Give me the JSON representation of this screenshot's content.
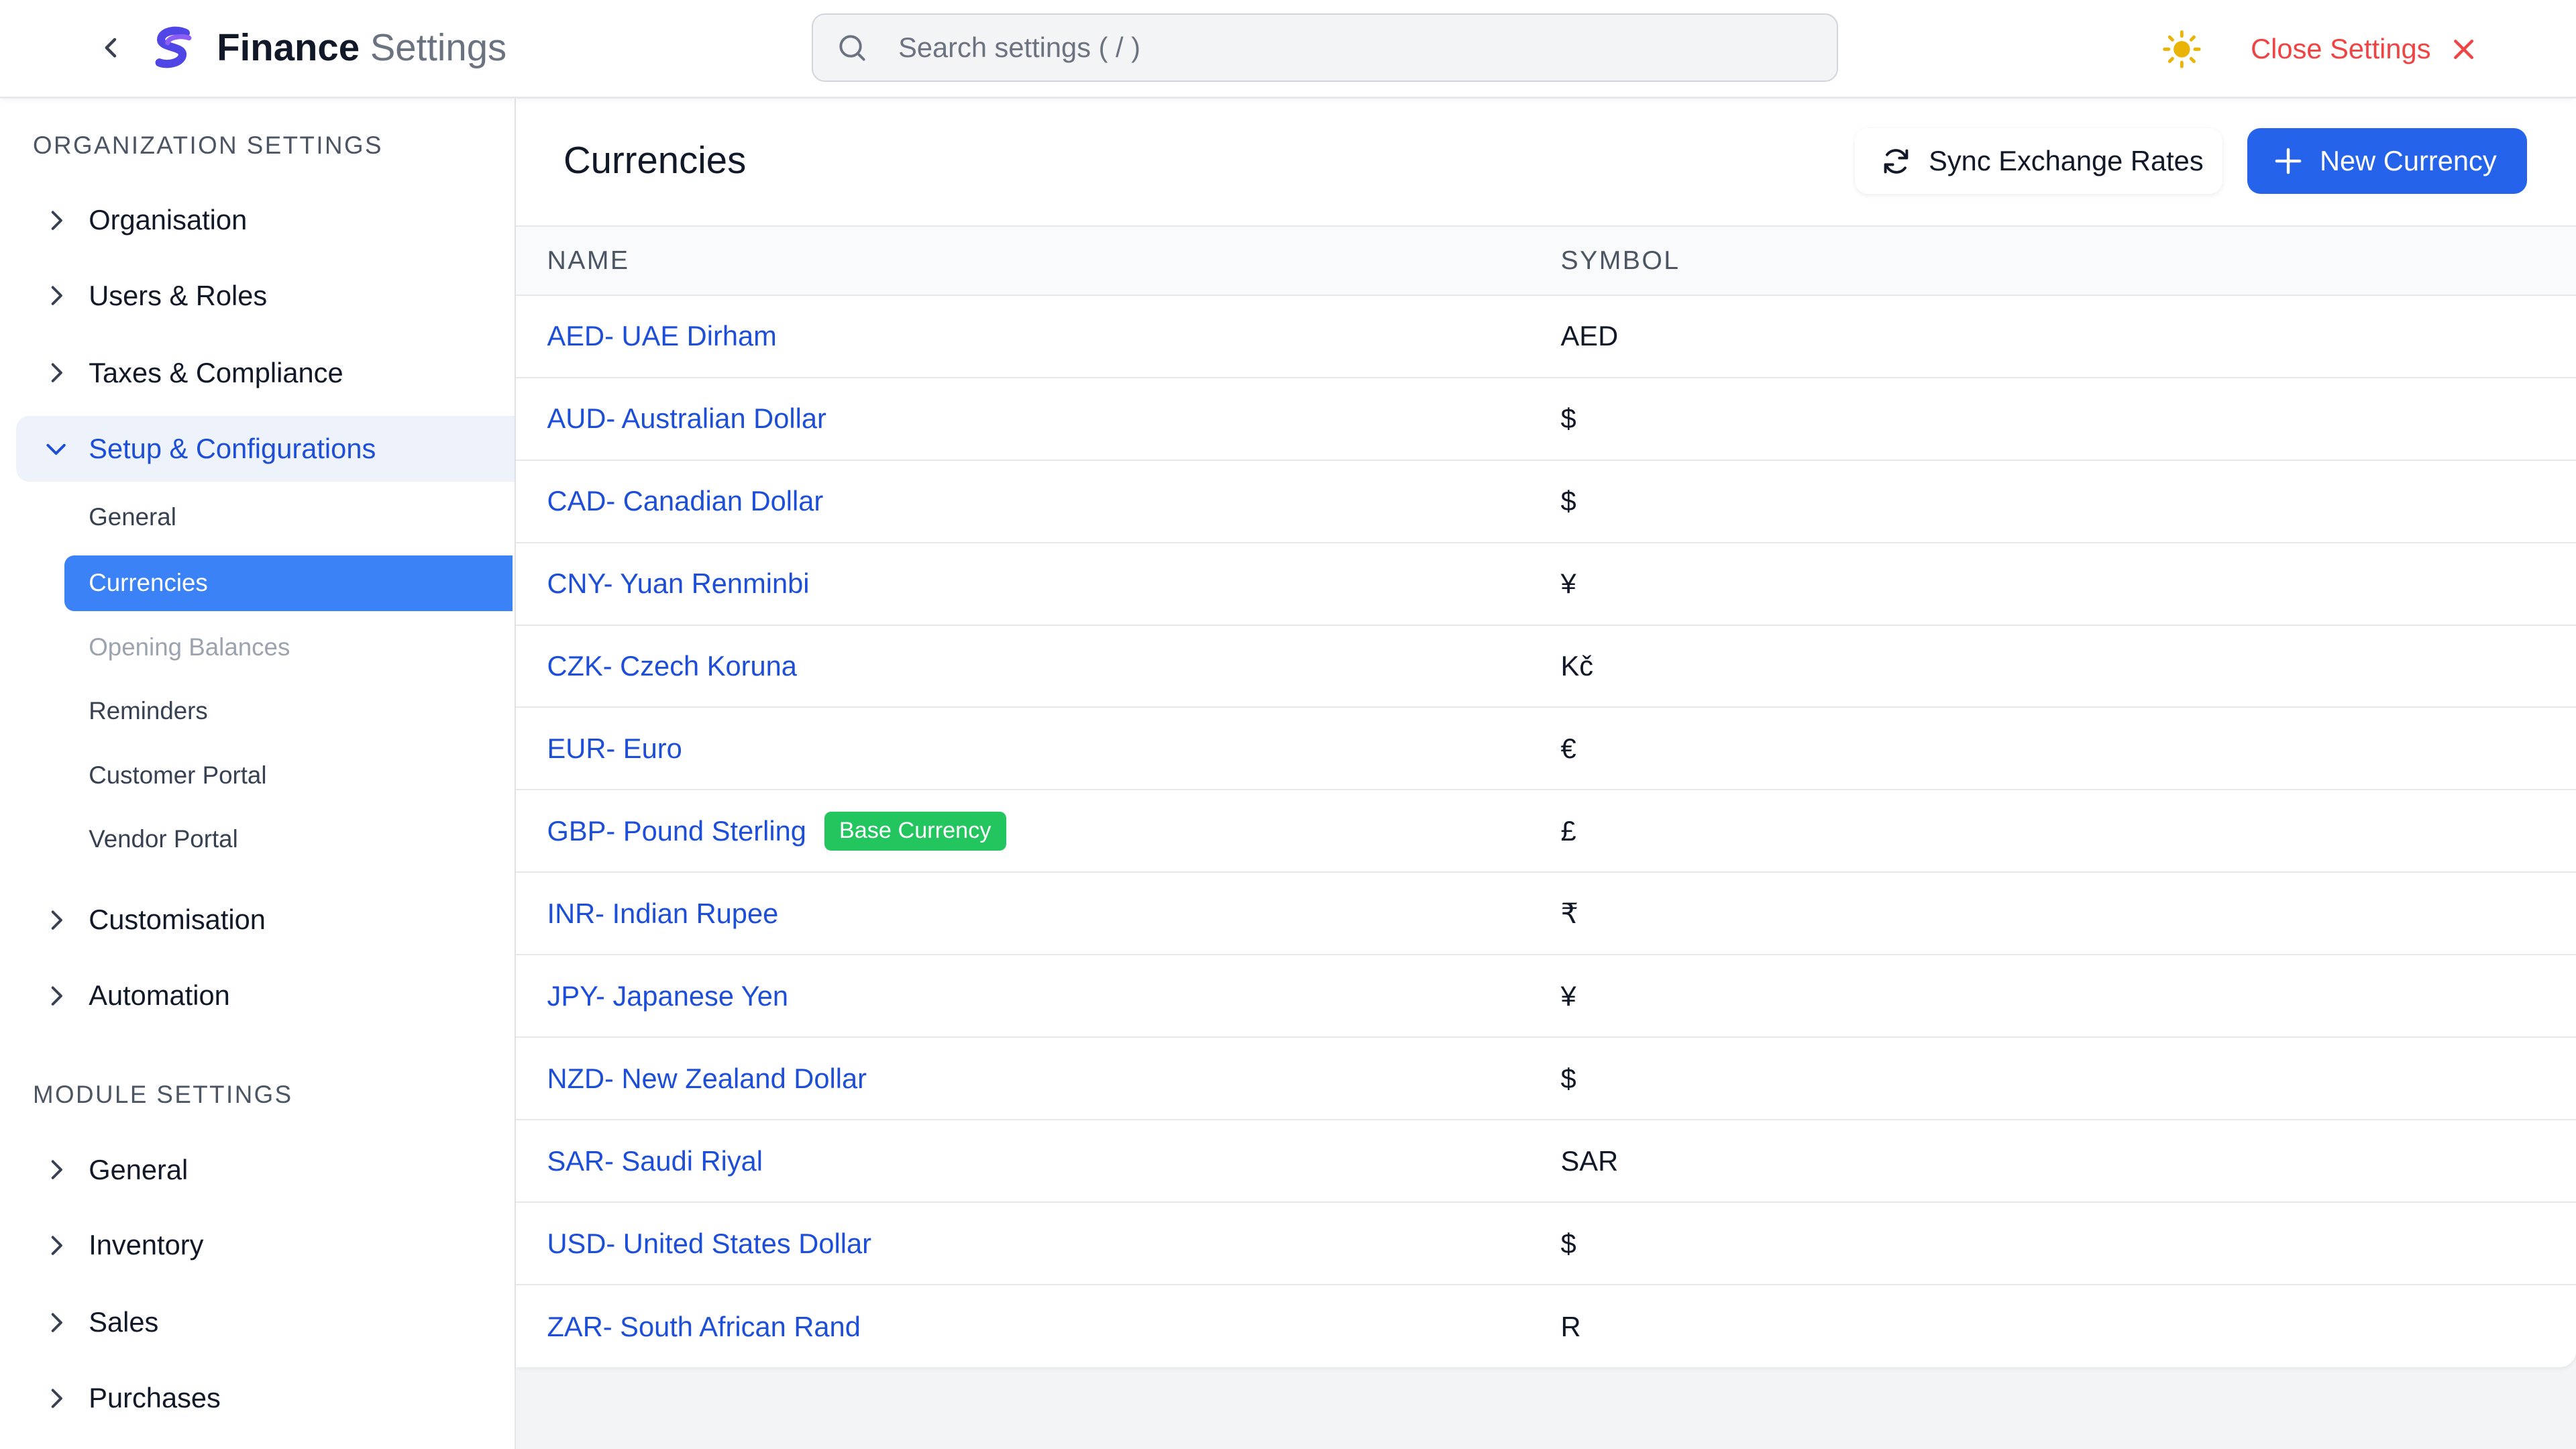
{
  "header": {
    "title_strong": "Finance",
    "title_light": "Settings",
    "search_placeholder": "Search settings ( / )",
    "close_label": "Close Settings"
  },
  "colors": {
    "accent": "#2563eb",
    "danger": "#ef4444",
    "badge": "#22c55e",
    "sun": "#eab308"
  },
  "sidebar": {
    "org_section": "ORGANIZATION SETTINGS",
    "org_items": [
      {
        "label": "Organisation"
      },
      {
        "label": "Users & Roles"
      },
      {
        "label": "Taxes & Compliance"
      },
      {
        "label": "Setup & Configurations"
      }
    ],
    "setup_subitems": [
      {
        "label": "General"
      },
      {
        "label": "Currencies"
      },
      {
        "label": "Opening Balances"
      },
      {
        "label": "Reminders"
      },
      {
        "label": "Customer Portal"
      },
      {
        "label": "Vendor Portal"
      }
    ],
    "org_items_after": [
      {
        "label": "Customisation"
      },
      {
        "label": "Automation"
      }
    ],
    "module_section": "MODULE SETTINGS",
    "module_items": [
      {
        "label": "General"
      },
      {
        "label": "Inventory"
      },
      {
        "label": "Sales"
      },
      {
        "label": "Purchases"
      }
    ]
  },
  "main": {
    "title": "Currencies",
    "sync_label": "Sync Exchange Rates",
    "new_label": "New Currency",
    "columns": {
      "name": "NAME",
      "symbol": "SYMBOL"
    },
    "base_badge": "Base Currency",
    "rows": [
      {
        "name": "AED- UAE Dirham",
        "symbol": "AED"
      },
      {
        "name": "AUD- Australian Dollar",
        "symbol": "$"
      },
      {
        "name": "CAD- Canadian Dollar",
        "symbol": "$"
      },
      {
        "name": "CNY- Yuan Renminbi",
        "symbol": "¥"
      },
      {
        "name": "CZK- Czech Koruna",
        "symbol": "Kč"
      },
      {
        "name": "EUR- Euro",
        "symbol": "€"
      },
      {
        "name": "GBP- Pound Sterling",
        "symbol": "£"
      },
      {
        "name": "INR- Indian Rupee",
        "symbol": "₹"
      },
      {
        "name": "JPY- Japanese Yen",
        "symbol": "¥"
      },
      {
        "name": "NZD- New Zealand Dollar",
        "symbol": "$"
      },
      {
        "name": "SAR- Saudi Riyal",
        "symbol": "SAR"
      },
      {
        "name": "USD- United States Dollar",
        "symbol": "$"
      },
      {
        "name": "ZAR- South African Rand",
        "symbol": "R"
      }
    ]
  }
}
